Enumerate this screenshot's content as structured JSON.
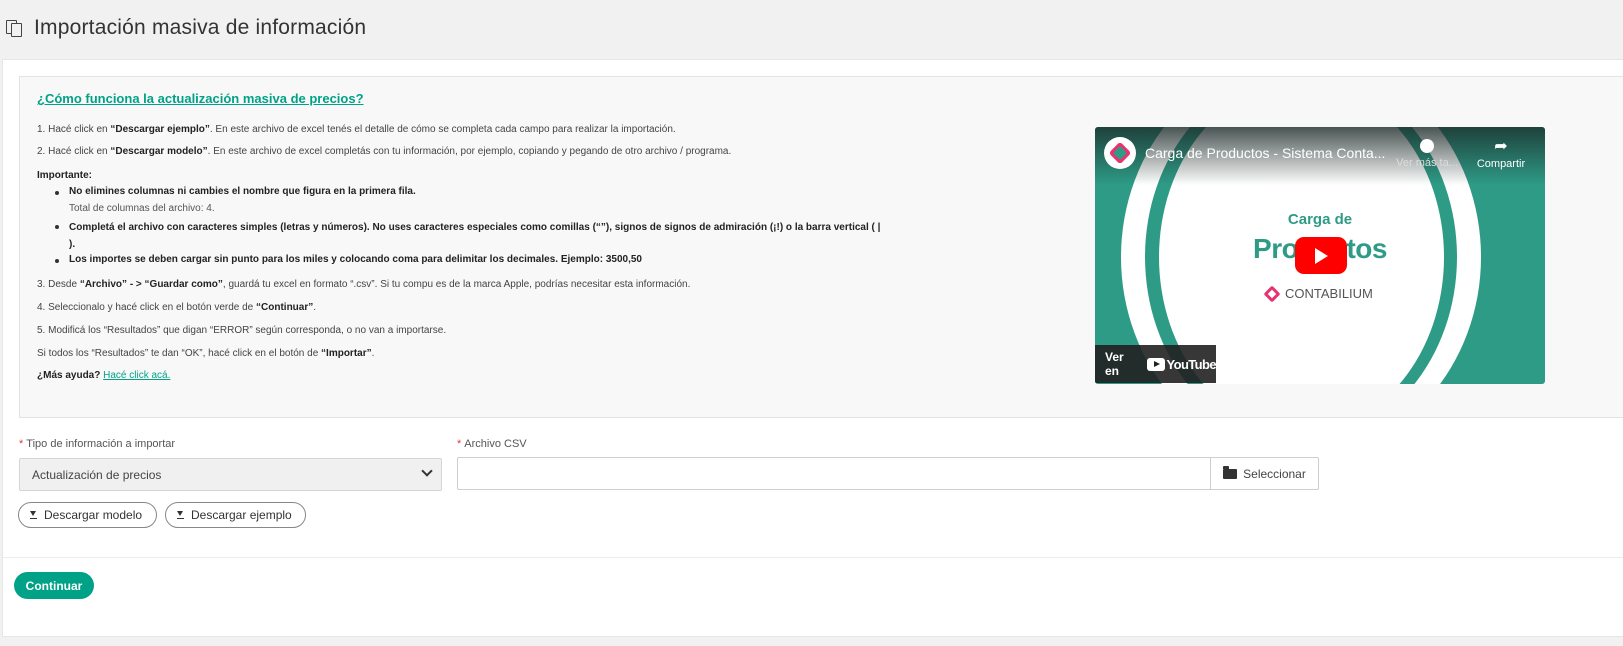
{
  "header": {
    "title": "Importación masiva de información",
    "icon": "copy-icon"
  },
  "info": {
    "title": "¿Cómo funciona la actualización masiva de precios?",
    "step1": {
      "pre": "1. Hacé click en ",
      "bold": "“Descargar ejemplo”",
      "post": ". En este archivo de excel tenés el detalle de cómo se completa cada campo para realizar la importación."
    },
    "step2": {
      "pre": "2. Hacé click en ",
      "bold": "“Descargar modelo”",
      "post": ". En este archivo de excel completás con tu información, por ejemplo, copiando y pegando de otro archivo / programa."
    },
    "important": "Importante:",
    "bullets": [
      {
        "text": "No elimines columnas ni cambies el nombre que figura en la primera fila.",
        "sub": "Total de columnas del archivo: 4."
      },
      {
        "text": "Completá el archivo con caracteres simples (letras y números). No uses caracteres especiales como comillas (“”), signos de signos de admiración (¡!) o la barra vertical ( | )."
      },
      {
        "text": "Los importes se deben cargar sin punto para los miles y colocando coma para delimitar los decimales. Ejemplo: 3500,50"
      }
    ],
    "step3": {
      "pre": "3. Desde ",
      "bold1": "“Archivo” - > “Guardar como”",
      "post": ", guardá tu excel en formato “.csv”. Si tu compu es de la marca Apple, podrías necesitar esta información."
    },
    "step4": {
      "pre": "4. Seleccionalo y hacé click en el botón verde de ",
      "bold": "“Continuar”",
      "post": "."
    },
    "step5": "5. Modificá los “Resultados” que digan “ERROR” según corresponda, o no van a importarse.",
    "step6": {
      "pre": "Si todos los “Resultados” te dan “OK”, hacé click en el botón de ",
      "bold": "“Importar”",
      "post": "."
    },
    "help": {
      "label": "¿Más ayuda?",
      "link": "Hacé click acá."
    }
  },
  "video": {
    "title": "Carga de Productos - Sistema Conta...",
    "watch_later": "Ver más ta...",
    "share": "Compartir",
    "slide_line1": "Carga de",
    "slide_line2": "Productos",
    "brand": "CONTABILIUM",
    "watch_on": "Ver en",
    "youtube": "YouTube"
  },
  "form": {
    "type_label": "Tipo de información a importar",
    "type_value": "Actualización de precios",
    "csv_label": "Archivo CSV",
    "select_button": "Seleccionar",
    "download_model": "Descargar modelo",
    "download_example": "Descargar ejemplo"
  },
  "footer": {
    "continue": "Continuar"
  },
  "colors": {
    "accent": "#00a287",
    "required": "#e53935",
    "video_bg": "#2e9b87",
    "play": "#ff0000"
  }
}
